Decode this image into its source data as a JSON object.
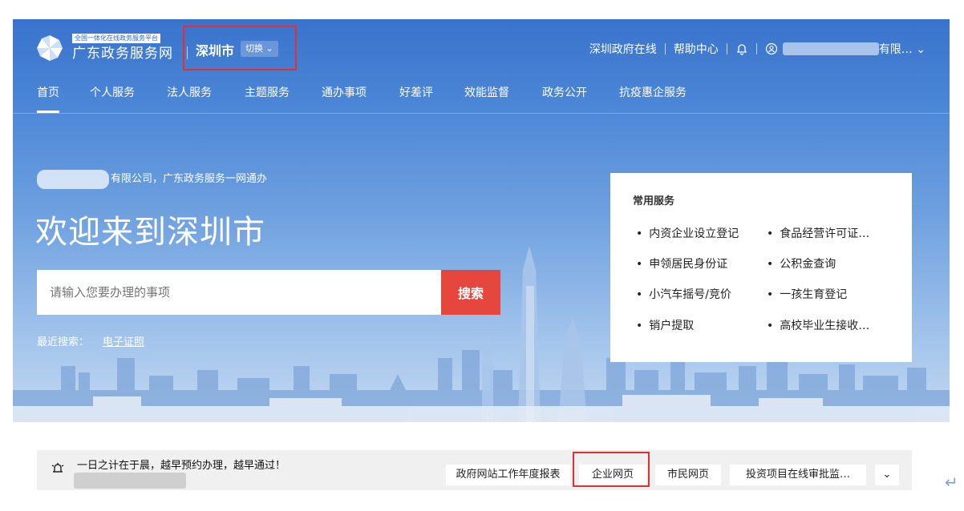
{
  "header": {
    "brand_sub": "全国一体化在线政务服务平台",
    "brand_main": "广东政务服务网",
    "city": "深圳市",
    "switch_label": "切换",
    "links": [
      "深圳政府在线",
      "帮助中心"
    ],
    "user_suffix": "有限…"
  },
  "nav": {
    "items": [
      "首页",
      "个人服务",
      "法人服务",
      "主题服务",
      "通办事项",
      "好差评",
      "效能监督",
      "政务公开",
      "抗疫惠企服务"
    ]
  },
  "hero": {
    "greeting": "有限公司，广东政务服务一网通办",
    "welcome": "欢迎来到深圳市",
    "search_placeholder": "请输入您要办理的事项",
    "search_button": "搜索",
    "recent_label": "最近搜索：",
    "recent_link": "电子证照"
  },
  "services": {
    "title": "常用服务",
    "items": [
      "内资企业设立登记",
      "食品经营许可证…",
      "申领居民身份证",
      "公积金查询",
      "小汽车摇号/竞价",
      "一孩生育登记",
      "销户提取",
      "高校毕业生接收…"
    ]
  },
  "bottom": {
    "notice": "一日之计在于晨，越早预约办理，越早通过！",
    "buttons": [
      "政府网站工作年度报表",
      "企业网页",
      "市民网页",
      "投资项目在线审批监…"
    ]
  },
  "colors": {
    "header_blue": "#3a73cc",
    "search_red": "#e5463d",
    "highlight_red": "#e23030"
  },
  "icons": [
    "pinwheel-logo-icon",
    "bell-icon",
    "user-circle-icon",
    "chevron-down-icon",
    "bullhorn-icon",
    "return-arrow-icon"
  ]
}
